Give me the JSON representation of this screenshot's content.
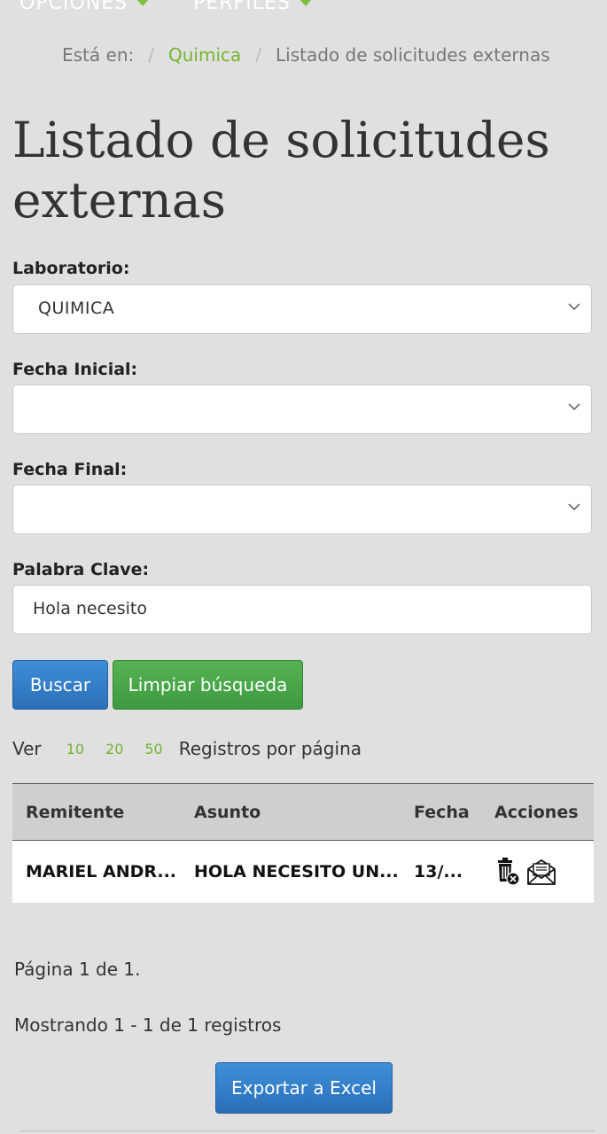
{
  "nav": {
    "options_label": "OPCIONES",
    "profiles_label": "PERFILES"
  },
  "breadcrumb": {
    "prefix": "Está en:",
    "parent": "Quimica",
    "current": "Listado de solicitudes externas"
  },
  "page_title": "Listado de solicitudes externas",
  "form": {
    "lab": {
      "label": "Laboratorio:",
      "value": "QUIMICA"
    },
    "start_date": {
      "label": "Fecha Inicial:",
      "value": ""
    },
    "end_date": {
      "label": "Fecha Final:",
      "value": ""
    },
    "keyword": {
      "label": "Palabra Clave:",
      "value": "Hola necesito"
    },
    "search_label": "Buscar",
    "clear_label": "Limpiar búsqueda"
  },
  "per_page": {
    "prefix": "Ver",
    "options": [
      "10",
      "20",
      "50"
    ],
    "suffix": "Registros por página"
  },
  "table": {
    "headers": [
      "Remitente",
      "Asunto",
      "Fecha",
      "Acciones"
    ],
    "rows": [
      {
        "sender": "MARIEL ANDR...",
        "subject": "HOLA NECESITO UN...",
        "date": "13/..."
      }
    ]
  },
  "pagination": {
    "page_text": "Página 1 de 1.",
    "showing_text": "Mostrando 1 - 1 de 1 registros"
  },
  "export_label": "Exportar a Excel",
  "colors": {
    "accent_green": "#74b52f",
    "button_blue": "#2a6fb8",
    "button_green": "#3e9a3e"
  }
}
